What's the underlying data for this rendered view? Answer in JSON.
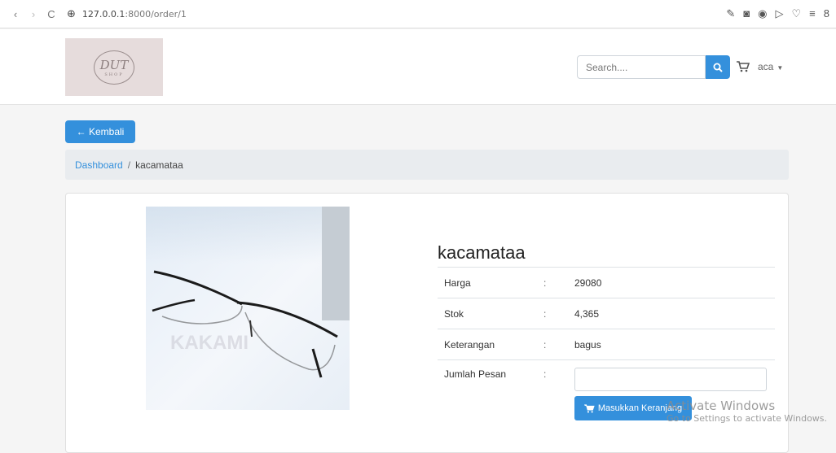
{
  "browser": {
    "url_host": "127.0.0.1",
    "url_path": ":8000/order/1",
    "nav_back": "‹",
    "nav_forward": "›",
    "reload": "C"
  },
  "navbar": {
    "logo_script": "DUT",
    "logo_small": "SHOP",
    "search": {
      "placeholder": "Search...."
    },
    "user_name": "aca"
  },
  "back_button": {
    "label": "← Kembali"
  },
  "breadcrumb": {
    "home": "Dashboard",
    "separator": "/",
    "current": "kacamataa"
  },
  "product": {
    "title": "kacamataa",
    "rows": [
      {
        "label": "Harga",
        "colon": ":",
        "value": "29080"
      },
      {
        "label": "Stok",
        "colon": ":",
        "value": "4,365"
      },
      {
        "label": "Keterangan",
        "colon": ":",
        "value": "bagus"
      },
      {
        "label": "Jumlah Pesan",
        "colon": ":"
      }
    ],
    "add_to_cart_label": "Masukkan Keranjang",
    "image_watermark": "KAKAMI"
  },
  "os_watermark": {
    "line1": "Activate Windows",
    "line2": "Go to Settings to activate Windows."
  },
  "colors": {
    "primary": "#3490dc",
    "breadcrumb_bg": "#e9ecef"
  }
}
